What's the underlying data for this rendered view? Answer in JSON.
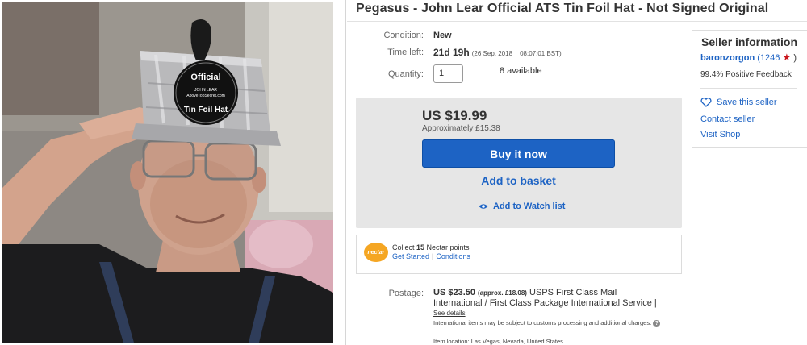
{
  "listing": {
    "title": "Pegasus - John Lear Official ATS Tin Foil Hat - Not Signed Original"
  },
  "photo": {
    "hat_badge_top": "Official",
    "hat_badge_mid1": "JOHN LEAR",
    "hat_badge_mid2": "AboveTopSecret.com",
    "hat_badge_bottom": "Tin Foil Hat"
  },
  "details": {
    "condition_label": "Condition:",
    "condition_value": "New",
    "time_left_label": "Time left:",
    "time_left_value": "21d 19h",
    "time_left_date": "(26 Sep, 2018",
    "time_left_time": "08:07:01 BST)",
    "quantity_label": "Quantity:",
    "quantity_value": "1",
    "available": "8 available"
  },
  "buybox": {
    "price": "US $19.99",
    "approx": "Approximately £15.38",
    "buy_label": "Buy it now",
    "basket_label": "Add to basket",
    "watch_label": "Add to Watch list"
  },
  "nectar": {
    "logo_text": "nectar",
    "collect_prefix": "Collect ",
    "points": "15",
    "collect_suffix": " Nectar points",
    "get_started": "Get Started",
    "separator": "|",
    "conditions": "Conditions"
  },
  "postage": {
    "label": "Postage:",
    "price": "US $23.50",
    "approx": "(approx. £18.08)",
    "service_line1": "USPS First Class Mail",
    "service_line2": "International / First Class Package International Service |",
    "see_details": "See details",
    "intl_note": "International items may be subject to customs processing and additional charges.",
    "help_glyph": "?",
    "item_location": "Item location:  Las Vegas, Nevada, United States"
  },
  "seller": {
    "heading": "Seller information",
    "name": "baronzorgon",
    "score": "(1246",
    "star_glyph": "★",
    "close_paren": ")",
    "feedback": "99.4% Positive Feedback",
    "save_label": "Save this seller",
    "contact_label": "Contact seller",
    "visit_label": "Visit Shop"
  },
  "colors": {
    "link_blue": "#1d63c4",
    "buy_button": "#1d63c4",
    "buybox_bg": "#e6e6e6",
    "nectar_orange": "#f5a623",
    "star_red": "#c9161d"
  }
}
